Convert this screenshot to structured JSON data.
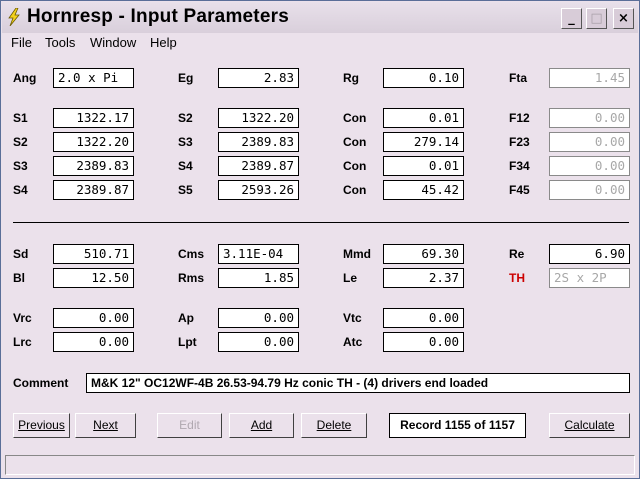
{
  "window": {
    "title": "Hornresp - Input Parameters",
    "minimize": "_",
    "maximize": "□",
    "close": "×"
  },
  "menu": [
    "File",
    "Tools",
    "Window",
    "Help"
  ],
  "params": {
    "Ang": {
      "label": "Ang",
      "value": "2.0 x Pi"
    },
    "Eg": {
      "label": "Eg",
      "value": "2.83"
    },
    "Rg": {
      "label": "Rg",
      "value": "0.10"
    },
    "Fta": {
      "label": "Fta",
      "value": "1.45"
    },
    "S1": {
      "label": "S1",
      "value": "1322.17"
    },
    "S2a": {
      "label": "S2",
      "value": "1322.20"
    },
    "Con1": {
      "label": "Con",
      "value": "0.01"
    },
    "F12": {
      "label": "F12",
      "value": "0.00"
    },
    "S2b": {
      "label": "S2",
      "value": "1322.20"
    },
    "S3a": {
      "label": "S3",
      "value": "2389.83"
    },
    "Con2": {
      "label": "Con",
      "value": "279.14"
    },
    "F23": {
      "label": "F23",
      "value": "0.00"
    },
    "S3b": {
      "label": "S3",
      "value": "2389.83"
    },
    "S4a": {
      "label": "S4",
      "value": "2389.87"
    },
    "Con3": {
      "label": "Con",
      "value": "0.01"
    },
    "F34": {
      "label": "F34",
      "value": "0.00"
    },
    "S4b": {
      "label": "S4",
      "value": "2389.87"
    },
    "S5": {
      "label": "S5",
      "value": "2593.26"
    },
    "Con4": {
      "label": "Con",
      "value": "45.42"
    },
    "F45": {
      "label": "F45",
      "value": "0.00"
    },
    "Sd": {
      "label": "Sd",
      "value": "510.71"
    },
    "Cms": {
      "label": "Cms",
      "value": "3.11E-04"
    },
    "Mmd": {
      "label": "Mmd",
      "value": "69.30"
    },
    "Re": {
      "label": "Re",
      "value": "6.90"
    },
    "Bl": {
      "label": "Bl",
      "value": "12.50"
    },
    "Rms": {
      "label": "Rms",
      "value": "1.85"
    },
    "Le": {
      "label": "Le",
      "value": "2.37"
    },
    "TH": {
      "label": "TH",
      "value": "2S x 2P"
    },
    "Vrc": {
      "label": "Vrc",
      "value": "0.00"
    },
    "Ap": {
      "label": "Ap",
      "value": "0.00"
    },
    "Vtc": {
      "label": "Vtc",
      "value": "0.00"
    },
    "Lrc": {
      "label": "Lrc",
      "value": "0.00"
    },
    "Lpt": {
      "label": "Lpt",
      "value": "0.00"
    },
    "Atc": {
      "label": "Atc",
      "value": "0.00"
    }
  },
  "comment": {
    "label": "Comment",
    "value": "M&K 12\" OC12WF-4B 26.53-94.79 Hz conic TH - (4) drivers end loaded"
  },
  "buttons": {
    "previous": "Previous",
    "next": "Next",
    "edit": "Edit",
    "add": "Add",
    "delete": "Delete",
    "calculate": "Calculate"
  },
  "record": "Record 1155 of 1157",
  "colors": {
    "window_bg": "#ebe1eb",
    "th_label": "#cc0000",
    "disabled_text": "#a8a8a8"
  }
}
